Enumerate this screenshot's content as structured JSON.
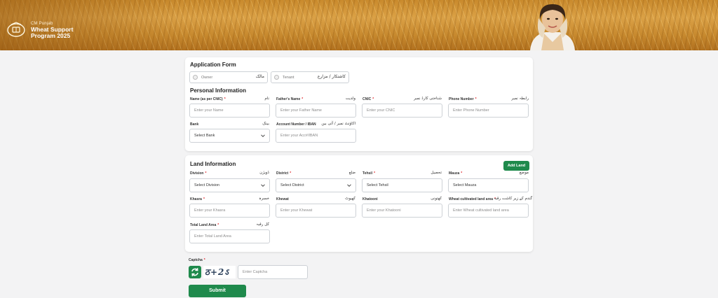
{
  "banner": {
    "brand_small": "CM Punjab",
    "brand_line1": "Wheat Support",
    "brand_line2": "Program 2025"
  },
  "form": {
    "title": "Application Form",
    "owner": {
      "label": "Owner",
      "urdu": "مالک"
    },
    "tenant": {
      "label": "Tenant",
      "urdu": "کاشتکار / مزارع"
    },
    "personal_title": "Personal Information",
    "name": {
      "label": "Name (as per CNIC)",
      "urdu": "نام",
      "placeholder": "Enter your  Name"
    },
    "father": {
      "label": "Father's Name",
      "urdu": "ولدیت",
      "placeholder": "Enter your Father Name"
    },
    "cnic": {
      "label": "CNIC",
      "urdu": "شناختی کارڈ نمبر",
      "placeholder": "Enter your CNIC"
    },
    "phone": {
      "label": "Phone Number",
      "urdu": "رابطہ نمبر",
      "placeholder": "Enter Phone Number"
    },
    "bank": {
      "label": "Bank",
      "urdu": "بینک",
      "value": "Select Bank"
    },
    "account": {
      "label": "Account Number / IBAN",
      "urdu": "اکاؤنٹ نمبر / آئی بین",
      "placeholder": "Enter your Acc#/IBAN"
    }
  },
  "land": {
    "title": "Land Information",
    "add_label": "Add Land",
    "division": {
      "label": "Division",
      "urdu": "ڈویژن",
      "value": "Select Division"
    },
    "district": {
      "label": "District",
      "urdu": "ضلع",
      "value": "Select District"
    },
    "tehsil": {
      "label": "Tehsil",
      "urdu": "تحصیل",
      "value": "Select Tehsil"
    },
    "mauza": {
      "label": "Mauza",
      "urdu": "موضع",
      "value": "Select Mauza"
    },
    "khasra": {
      "label": "Khasra",
      "urdu": "خسرہ",
      "placeholder": "Enter your Khasra"
    },
    "khewat": {
      "label": "Khewat",
      "urdu": "کھیوٹ",
      "placeholder": "Enter your Khewat"
    },
    "khatooni": {
      "label": "Khatooni",
      "urdu": "کھتونی",
      "placeholder": "Enter your Khatooni"
    },
    "wheat_area": {
      "label": "Wheat cultivated land area",
      "urdu": "گندم کے زیر کاشت رقبہ",
      "placeholder": "Enter Wheat cultivated land area"
    },
    "total_area": {
      "label": "Total Land Area",
      "urdu": "کل رقبہ",
      "placeholder": "Enter Total Land Area"
    }
  },
  "captcha": {
    "label": "Captcha",
    "image_text": "ठ+2ऽ",
    "placeholder": "Enter Captcha"
  },
  "submit_label": "Submit",
  "colors": {
    "accent": "#1f8a4c",
    "required": "#e0262b",
    "banner": "#d49a3e"
  }
}
